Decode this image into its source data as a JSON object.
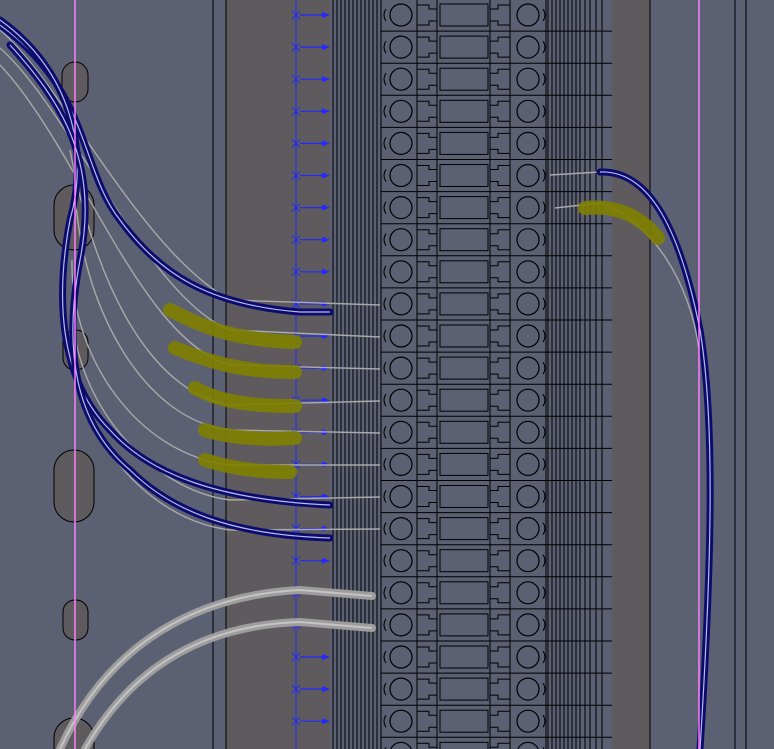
{
  "drawing": {
    "colors": {
      "background": "#5b6072",
      "rail": "#5e5a5e",
      "terminal_line": "#000000",
      "cable_blue": "#0c0c6e",
      "cable_highlight": "#b8bbe8",
      "wire_gray": "#a9a9a9",
      "cable_gray": "#9d9d9d",
      "marker_blue": "#1f2bff",
      "guide_magenta": "#ff7dff",
      "label_yellow": "#7f7f00"
    },
    "terminal_block": {
      "terminal_count": 24
    }
  }
}
